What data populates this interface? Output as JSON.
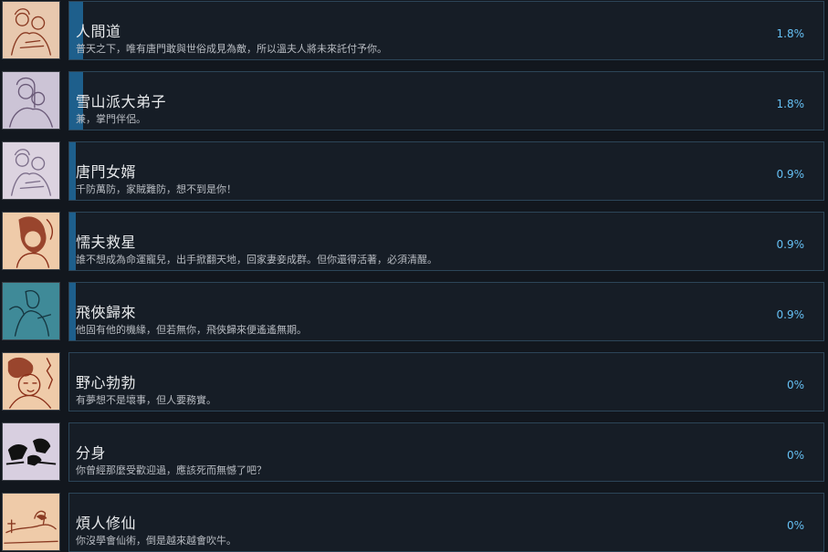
{
  "achievements": [
    {
      "title": "人間道",
      "description": "普天之下，唯有唐門敢與世俗成見為敵，所以溫夫人將未來託付予你。",
      "percent_label": "1.8%",
      "percent": 1.8,
      "icon": "sketch-couple-icon",
      "palette": {
        "bg": "#e8c8ae",
        "ink": "#8a3a22"
      }
    },
    {
      "title": "雪山派大弟子",
      "description": "兼，掌門伴侶。",
      "percent_label": "1.8%",
      "percent": 1.8,
      "icon": "sketch-embrace-icon",
      "palette": {
        "bg": "#ccc4d6",
        "ink": "#6a5a78"
      }
    },
    {
      "title": "唐門女婿",
      "description": "千防萬防，家賊難防，想不到是你！",
      "percent_label": "0.9%",
      "percent": 0.9,
      "icon": "sketch-couple-icon",
      "palette": {
        "bg": "#dcd3e0",
        "ink": "#7c6e8a"
      }
    },
    {
      "title": "懦夫救星",
      "description": "誰不想成為命運寵兒，出手掀翻天地，回家妻妾成群。但你還得活著，必須清醒。",
      "percent_label": "0.9%",
      "percent": 0.9,
      "icon": "sketch-woman-icon",
      "palette": {
        "bg": "#efcba9",
        "ink": "#8a2e18"
      }
    },
    {
      "title": "飛俠歸來",
      "description": "他固有他的機緣，但若無你，飛俠歸來便遙遙無期。",
      "percent_label": "0.9%",
      "percent": 0.9,
      "icon": "sketch-figure-icon",
      "palette": {
        "bg": "#3f8a98",
        "ink": "#163640"
      }
    },
    {
      "title": "野心勃勃",
      "description": "有夢想不是壞事，但人要務實。",
      "percent_label": "0%",
      "percent": 0,
      "icon": "sketch-face-icon",
      "palette": {
        "bg": "#efcba9",
        "ink": "#8a2e18"
      }
    },
    {
      "title": "分身",
      "description": "你曾經那麼受歡迎過，應該死而無憾了吧？",
      "percent_label": "0%",
      "percent": 0,
      "icon": "ink-figures-icon",
      "palette": {
        "bg": "#d8cfe0",
        "ink": "#111111"
      }
    },
    {
      "title": "煩人修仙",
      "description": "你沒學會仙術，倒是越來越會吹牛。",
      "percent_label": "0%",
      "percent": 0,
      "icon": "sketch-scene-icon",
      "palette": {
        "bg": "#efcba9",
        "ink": "#8a3a22"
      }
    }
  ]
}
